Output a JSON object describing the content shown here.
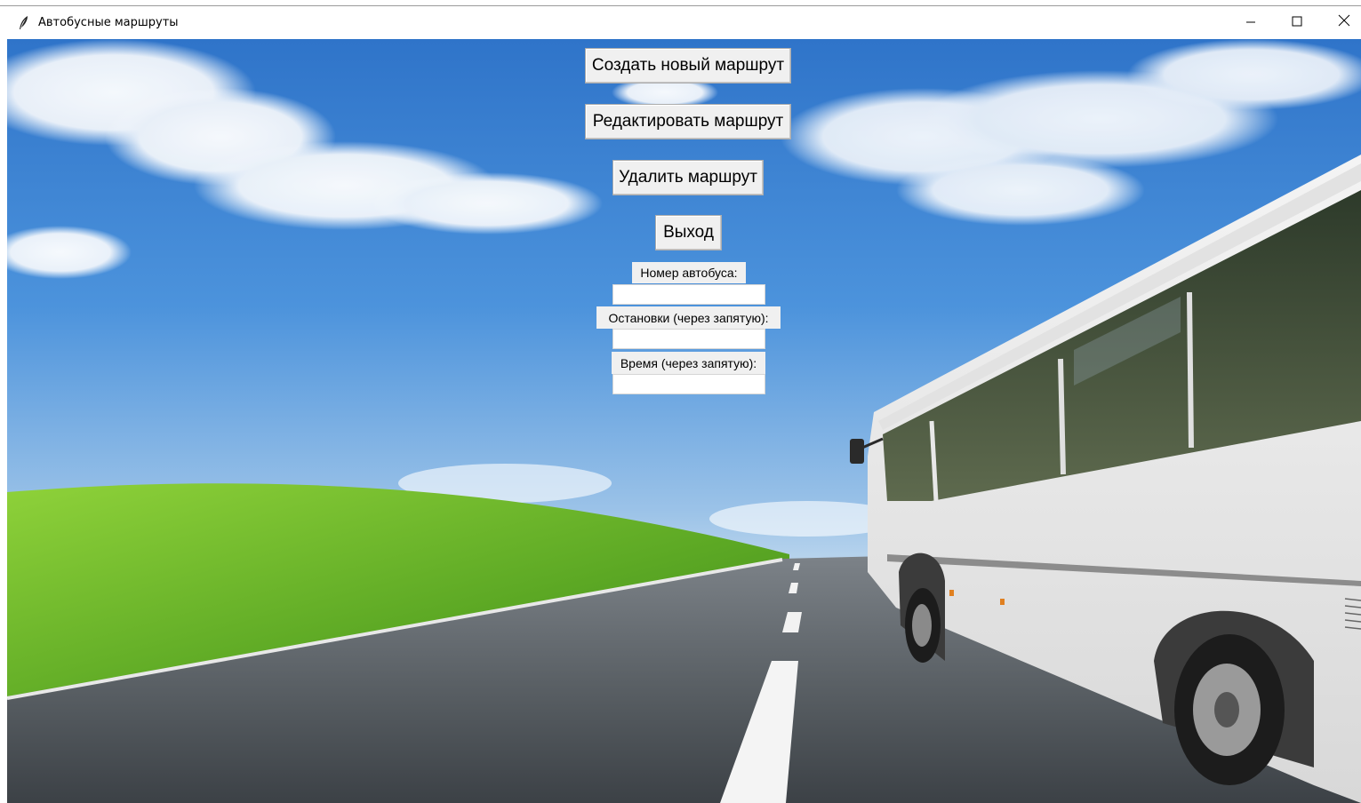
{
  "window": {
    "title": "Автобусные маршруты"
  },
  "icons": {
    "app": "feather-icon",
    "minimize": "minimize-icon",
    "maximize": "maximize-icon",
    "close": "close-icon"
  },
  "buttons": {
    "create_route": "Создать новый маршрут",
    "edit_route": "Редактировать маршрут",
    "delete_route": "Удалить маршрут",
    "exit": "Выход"
  },
  "form": {
    "bus_number_label": "Номер автобуса:",
    "bus_number_value": "",
    "stops_label": "Остановки (через запятую):",
    "stops_value": "",
    "times_label": "Время (через запятую):",
    "times_value": ""
  },
  "colors": {
    "sky_top": "#3d86d8",
    "sky_bottom": "#c7ddef",
    "grass": "#6cb82a",
    "road": "#5a6066",
    "button_bg": "#f0f0f0"
  }
}
